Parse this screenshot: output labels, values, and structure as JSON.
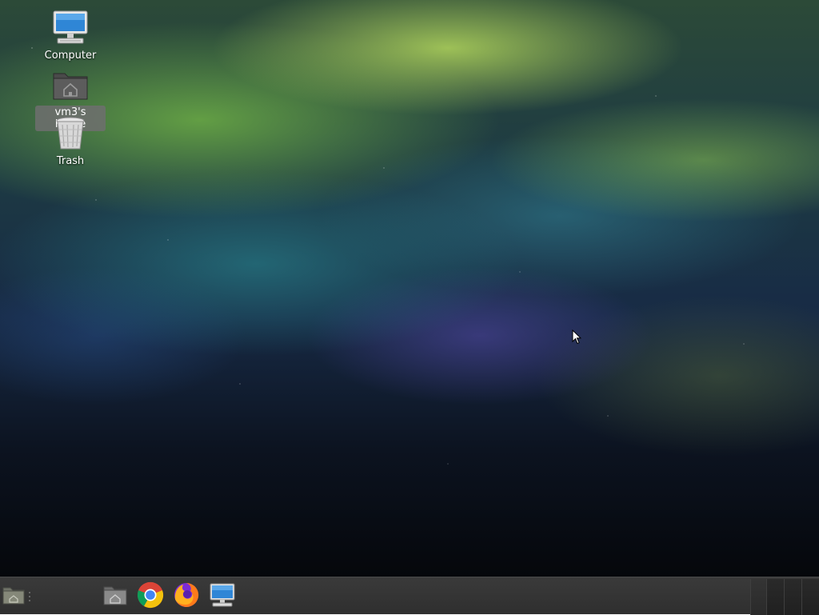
{
  "desktop": {
    "icons": [
      {
        "label": "Computer",
        "icon": "computer-icon"
      },
      {
        "label": "vm3's Home",
        "icon": "home-folder-icon",
        "selected": true
      },
      {
        "label": "Trash",
        "icon": "trash-icon"
      }
    ]
  },
  "panel": {
    "menu": {
      "icon": "menu-icon"
    },
    "launchers": [
      {
        "icon": "files-folder-icon"
      },
      {
        "icon": "chrome-icon"
      },
      {
        "icon": "firefox-icon"
      },
      {
        "icon": "terminal-monitor-icon"
      }
    ]
  },
  "colors": {
    "panel_bg": "#333333",
    "label_highlight": "#6e6e6e",
    "computer_blue": "#3a8fd8"
  }
}
